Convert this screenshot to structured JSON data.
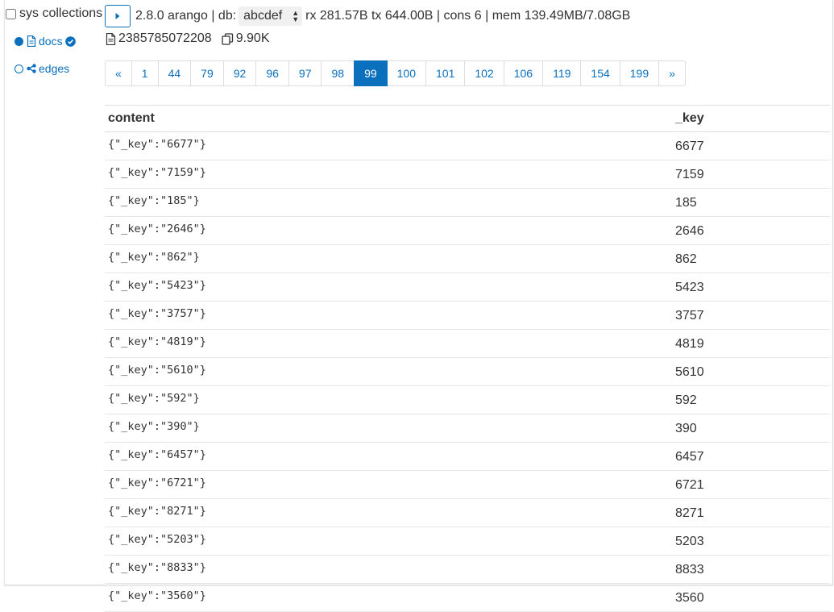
{
  "sidebar": {
    "sys_collections_label": "sys collections",
    "items": [
      {
        "label": "docs",
        "selected": true
      },
      {
        "label": "edges",
        "selected": false
      }
    ]
  },
  "topbar": {
    "version": "2.8.0 arango",
    "db_prefix": "| db:",
    "db_value": "abcdef",
    "stats": "rx 281.57B tx 644.00B | cons 6 | mem 139.49MB/7.08GB"
  },
  "info": {
    "doc_count": "2385785072208",
    "size": "9.90K"
  },
  "pagination": {
    "prev": "«",
    "next": "»",
    "pages": [
      "1",
      "44",
      "79",
      "92",
      "96",
      "97",
      "98",
      "99",
      "100",
      "101",
      "102",
      "106",
      "119",
      "154",
      "199"
    ],
    "active": "99"
  },
  "table": {
    "headers": {
      "content": "content",
      "key": "_key"
    },
    "rows": [
      {
        "content": "{\"_key\":\"6677\"}",
        "key": "6677"
      },
      {
        "content": "{\"_key\":\"7159\"}",
        "key": "7159"
      },
      {
        "content": "{\"_key\":\"185\"}",
        "key": "185"
      },
      {
        "content": "{\"_key\":\"2646\"}",
        "key": "2646"
      },
      {
        "content": "{\"_key\":\"862\"}",
        "key": "862"
      },
      {
        "content": "{\"_key\":\"5423\"}",
        "key": "5423"
      },
      {
        "content": "{\"_key\":\"3757\"}",
        "key": "3757"
      },
      {
        "content": "{\"_key\":\"4819\"}",
        "key": "4819"
      },
      {
        "content": "{\"_key\":\"5610\"}",
        "key": "5610"
      },
      {
        "content": "{\"_key\":\"592\"}",
        "key": "592"
      },
      {
        "content": "{\"_key\":\"390\"}",
        "key": "390"
      },
      {
        "content": "{\"_key\":\"6457\"}",
        "key": "6457"
      },
      {
        "content": "{\"_key\":\"6721\"}",
        "key": "6721"
      },
      {
        "content": "{\"_key\":\"8271\"}",
        "key": "8271"
      },
      {
        "content": "{\"_key\":\"5203\"}",
        "key": "5203"
      },
      {
        "content": "{\"_key\":\"8833\"}",
        "key": "8833"
      },
      {
        "content": "{\"_key\":\"3560\"}",
        "key": "3560"
      }
    ]
  },
  "colors": {
    "accent": "#0a6fbd",
    "border": "#dddddd",
    "text": "#333333"
  },
  "icons": {
    "play": "play-icon",
    "document": "document-icon",
    "copy": "copy-icon",
    "check": "check-circle-icon",
    "share": "share-nodes-icon"
  }
}
